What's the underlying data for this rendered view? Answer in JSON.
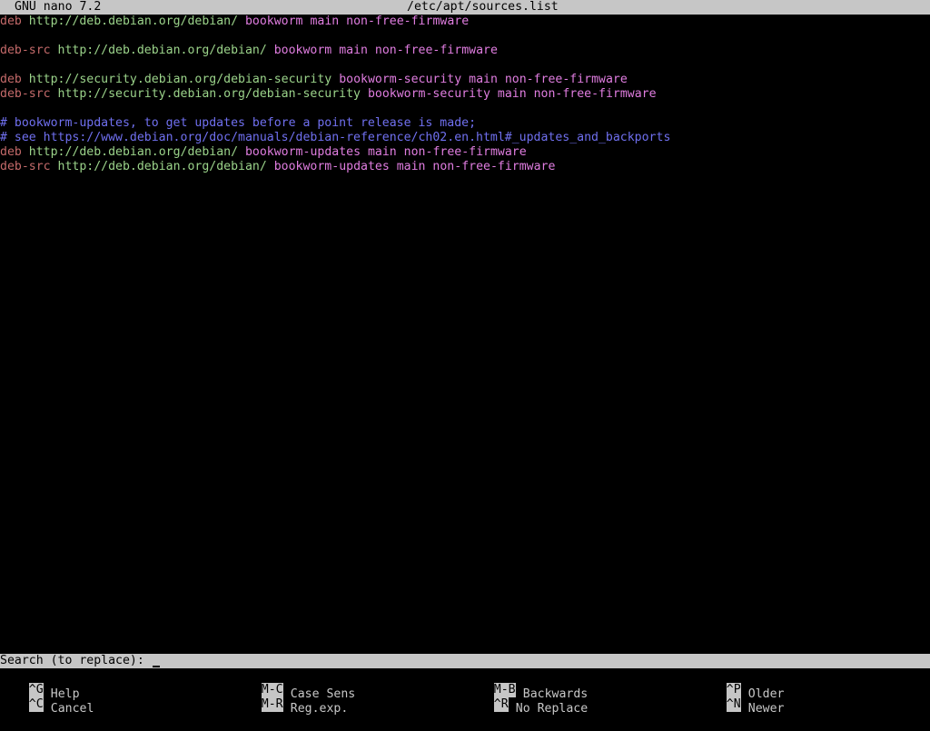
{
  "titlebar": {
    "app": "GNU nano 7.2",
    "file": "/etc/apt/sources.list"
  },
  "lines": [
    [
      {
        "t": "deb",
        "c": "type"
      },
      {
        "t": " "
      },
      {
        "t": "http://deb.debian.org/debian/",
        "c": "url"
      },
      {
        "t": " "
      },
      {
        "t": "bookworm",
        "c": "dist"
      },
      {
        "t": " "
      },
      {
        "t": "main non-free-firmware",
        "c": "comp"
      }
    ],
    [],
    [
      {
        "t": "deb-src",
        "c": "type"
      },
      {
        "t": " "
      },
      {
        "t": "http://deb.debian.org/debian/",
        "c": "url"
      },
      {
        "t": " "
      },
      {
        "t": "bookworm",
        "c": "dist"
      },
      {
        "t": " "
      },
      {
        "t": "main non-free-firmware",
        "c": "comp"
      }
    ],
    [],
    [
      {
        "t": "deb",
        "c": "type"
      },
      {
        "t": " "
      },
      {
        "t": "http://security.debian.org/debian-security",
        "c": "url"
      },
      {
        "t": " "
      },
      {
        "t": "bookworm-security",
        "c": "dist"
      },
      {
        "t": " "
      },
      {
        "t": "main non-free-firmware",
        "c": "comp"
      }
    ],
    [
      {
        "t": "deb-src",
        "c": "type"
      },
      {
        "t": " "
      },
      {
        "t": "http://security.debian.org/debian-security",
        "c": "url"
      },
      {
        "t": " "
      },
      {
        "t": "bookworm-security",
        "c": "dist"
      },
      {
        "t": " "
      },
      {
        "t": "main non-free-firmware",
        "c": "comp"
      }
    ],
    [],
    [
      {
        "t": "# bookworm-updates, to get updates before a point release is made;",
        "c": "comment"
      }
    ],
    [
      {
        "t": "# see https://www.debian.org/doc/manuals/debian-reference/ch02.en.html#_updates_and_backports",
        "c": "comment"
      }
    ],
    [
      {
        "t": "deb",
        "c": "type"
      },
      {
        "t": " "
      },
      {
        "t": "http://deb.debian.org/debian/",
        "c": "url"
      },
      {
        "t": " "
      },
      {
        "t": "bookworm-updates",
        "c": "dist"
      },
      {
        "t": " "
      },
      {
        "t": "main non-free-firmware",
        "c": "comp"
      }
    ],
    [
      {
        "t": "deb-src",
        "c": "type"
      },
      {
        "t": " "
      },
      {
        "t": "http://deb.debian.org/debian/",
        "c": "url"
      },
      {
        "t": " "
      },
      {
        "t": "bookworm-updates",
        "c": "dist"
      },
      {
        "t": " "
      },
      {
        "t": "main non-free-firmware",
        "c": "comp"
      }
    ]
  ],
  "search": {
    "prompt": "Search (to replace):",
    "value": ""
  },
  "shortcuts": {
    "help": {
      "key": "^G",
      "label": "Help"
    },
    "cancel": {
      "key": "^C",
      "label": "Cancel"
    },
    "case_sens": {
      "key": "M-C",
      "label": "Case Sens"
    },
    "reg_exp": {
      "key": "M-R",
      "label": "Reg.exp."
    },
    "backwards": {
      "key": "M-B",
      "label": "Backwards"
    },
    "no_replace": {
      "key": "^R",
      "label": "No Replace"
    },
    "older": {
      "key": "^P",
      "label": "Older"
    },
    "newer": {
      "key": "^N",
      "label": "Newer"
    }
  },
  "colors": {
    "type": "#c46a6a",
    "url": "#9bd38a",
    "dist": "#e07de0",
    "comment": "#7070f0",
    "bar": "#c6c6c6",
    "background": "#000000"
  }
}
